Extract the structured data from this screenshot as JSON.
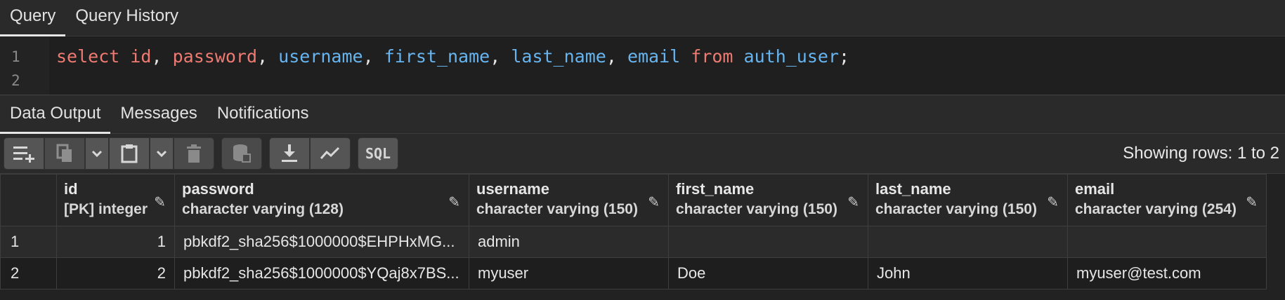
{
  "top_tabs": [
    "Query",
    "Query History"
  ],
  "editor": {
    "line_numbers": [
      "1",
      "2"
    ],
    "tokens": {
      "select": "select",
      "id": "id",
      "c1": ",",
      "password": "password",
      "c2": ",",
      "username": "username",
      "c3": ",",
      "first_name": "first_name",
      "c4": ",",
      "last_name": "last_name",
      "c5": ",",
      "email": "email",
      "from": "from",
      "table": "auth_user",
      "semi": ";"
    }
  },
  "output_tabs": [
    "Data Output",
    "Messages",
    "Notifications"
  ],
  "toolbar": {
    "icons": {
      "add_row": "add-row-icon",
      "copy": "copy-icon",
      "copy_menu": "chevron-down-icon",
      "paste": "paste-icon",
      "paste_menu": "chevron-down-icon",
      "delete": "trash-icon",
      "save_data": "database-save-icon",
      "download": "download-icon",
      "graph": "graph-icon"
    },
    "sql_label": "SQL",
    "status": "Showing rows: 1 to 2"
  },
  "grid": {
    "columns": [
      {
        "name": "id",
        "type": "[PK] integer"
      },
      {
        "name": "password",
        "type": "character varying (128)"
      },
      {
        "name": "username",
        "type": "character varying (150)"
      },
      {
        "name": "first_name",
        "type": "character varying (150)"
      },
      {
        "name": "last_name",
        "type": "character varying (150)"
      },
      {
        "name": "email",
        "type": "character varying (254)"
      }
    ],
    "rows": [
      {
        "row_num": "1",
        "cells": [
          "1",
          "pbkdf2_sha256$1000000$EHPHxMG...",
          "admin",
          "",
          "",
          ""
        ]
      },
      {
        "row_num": "2",
        "cells": [
          "2",
          "pbkdf2_sha256$1000000$YQaj8x7BS...",
          "myuser",
          "Doe",
          "John",
          "myuser@test.com"
        ]
      }
    ]
  },
  "colors": {
    "keyword": "#ee7a72",
    "identifier": "#67b5f0",
    "background": "#222222"
  }
}
